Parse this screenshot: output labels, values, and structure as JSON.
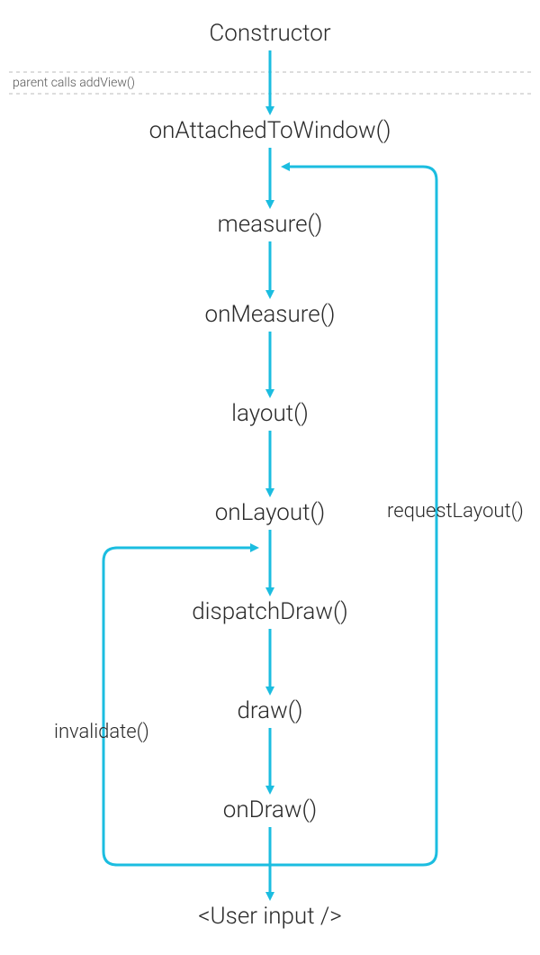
{
  "chart_data": {
    "type": "flowchart",
    "title": "",
    "nodes": [
      {
        "id": "constructor",
        "label": "Constructor"
      },
      {
        "id": "onAttachedToWindow",
        "label": "onAttachedToWindow()"
      },
      {
        "id": "measure",
        "label": "measure()"
      },
      {
        "id": "onMeasure",
        "label": "onMeasure()"
      },
      {
        "id": "layout",
        "label": "layout()"
      },
      {
        "id": "onLayout",
        "label": "onLayout()"
      },
      {
        "id": "dispatchDraw",
        "label": "dispatchDraw()"
      },
      {
        "id": "draw",
        "label": "draw()"
      },
      {
        "id": "onDraw",
        "label": "onDraw()"
      },
      {
        "id": "userInput",
        "label": "<User input />"
      }
    ],
    "edges": [
      {
        "from": "constructor",
        "to": "onAttachedToWindow"
      },
      {
        "from": "onAttachedToWindow",
        "to": "measure"
      },
      {
        "from": "measure",
        "to": "onMeasure"
      },
      {
        "from": "onMeasure",
        "to": "layout"
      },
      {
        "from": "layout",
        "to": "onLayout"
      },
      {
        "from": "onLayout",
        "to": "dispatchDraw"
      },
      {
        "from": "dispatchDraw",
        "to": "draw"
      },
      {
        "from": "draw",
        "to": "onDraw"
      },
      {
        "from": "onDraw",
        "to": "userInput"
      },
      {
        "from": "userInput",
        "to": "measure",
        "label": "requestLayout()",
        "loop": "right"
      },
      {
        "from": "userInput",
        "to": "dispatchDraw",
        "label": "invalidate()",
        "loop": "left"
      }
    ],
    "annotations": [
      {
        "text": "parent calls addView()",
        "between": [
          "constructor",
          "onAttachedToWindow"
        ]
      }
    ]
  },
  "nodes": {
    "constructor": "Constructor",
    "onAttachedToWindow": "onAttachedToWindow()",
    "measure": "measure()",
    "onMeasure": "onMeasure()",
    "layout": "layout()",
    "onLayout": "onLayout()",
    "dispatchDraw": "dispatchDraw()",
    "draw": "draw()",
    "onDraw": "onDraw()",
    "userInput": "<User input />"
  },
  "labels": {
    "divider": "parent calls addView()",
    "requestLayout": "requestLayout()",
    "invalidate": "invalidate()"
  },
  "colors": {
    "arrow": "#1bbde0",
    "divider": "#bbbbbb"
  }
}
